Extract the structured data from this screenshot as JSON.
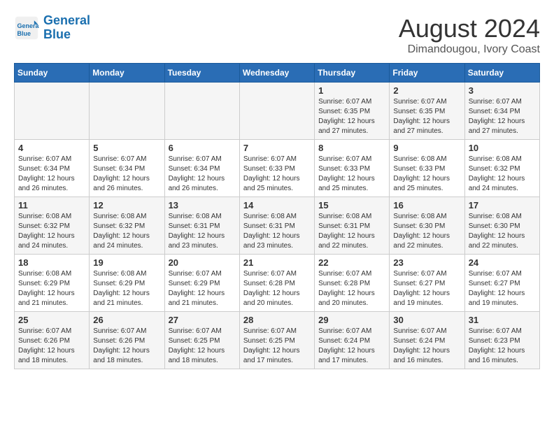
{
  "header": {
    "logo_line1": "General",
    "logo_line2": "Blue",
    "month_year": "August 2024",
    "location": "Dimandougou, Ivory Coast"
  },
  "days_of_week": [
    "Sunday",
    "Monday",
    "Tuesday",
    "Wednesday",
    "Thursday",
    "Friday",
    "Saturday"
  ],
  "weeks": [
    [
      {
        "day": "",
        "info": ""
      },
      {
        "day": "",
        "info": ""
      },
      {
        "day": "",
        "info": ""
      },
      {
        "day": "",
        "info": ""
      },
      {
        "day": "1",
        "info": "Sunrise: 6:07 AM\nSunset: 6:35 PM\nDaylight: 12 hours\nand 27 minutes."
      },
      {
        "day": "2",
        "info": "Sunrise: 6:07 AM\nSunset: 6:35 PM\nDaylight: 12 hours\nand 27 minutes."
      },
      {
        "day": "3",
        "info": "Sunrise: 6:07 AM\nSunset: 6:34 PM\nDaylight: 12 hours\nand 27 minutes."
      }
    ],
    [
      {
        "day": "4",
        "info": "Sunrise: 6:07 AM\nSunset: 6:34 PM\nDaylight: 12 hours\nand 26 minutes."
      },
      {
        "day": "5",
        "info": "Sunrise: 6:07 AM\nSunset: 6:34 PM\nDaylight: 12 hours\nand 26 minutes."
      },
      {
        "day": "6",
        "info": "Sunrise: 6:07 AM\nSunset: 6:34 PM\nDaylight: 12 hours\nand 26 minutes."
      },
      {
        "day": "7",
        "info": "Sunrise: 6:07 AM\nSunset: 6:33 PM\nDaylight: 12 hours\nand 25 minutes."
      },
      {
        "day": "8",
        "info": "Sunrise: 6:07 AM\nSunset: 6:33 PM\nDaylight: 12 hours\nand 25 minutes."
      },
      {
        "day": "9",
        "info": "Sunrise: 6:08 AM\nSunset: 6:33 PM\nDaylight: 12 hours\nand 25 minutes."
      },
      {
        "day": "10",
        "info": "Sunrise: 6:08 AM\nSunset: 6:32 PM\nDaylight: 12 hours\nand 24 minutes."
      }
    ],
    [
      {
        "day": "11",
        "info": "Sunrise: 6:08 AM\nSunset: 6:32 PM\nDaylight: 12 hours\nand 24 minutes."
      },
      {
        "day": "12",
        "info": "Sunrise: 6:08 AM\nSunset: 6:32 PM\nDaylight: 12 hours\nand 24 minutes."
      },
      {
        "day": "13",
        "info": "Sunrise: 6:08 AM\nSunset: 6:31 PM\nDaylight: 12 hours\nand 23 minutes."
      },
      {
        "day": "14",
        "info": "Sunrise: 6:08 AM\nSunset: 6:31 PM\nDaylight: 12 hours\nand 23 minutes."
      },
      {
        "day": "15",
        "info": "Sunrise: 6:08 AM\nSunset: 6:31 PM\nDaylight: 12 hours\nand 22 minutes."
      },
      {
        "day": "16",
        "info": "Sunrise: 6:08 AM\nSunset: 6:30 PM\nDaylight: 12 hours\nand 22 minutes."
      },
      {
        "day": "17",
        "info": "Sunrise: 6:08 AM\nSunset: 6:30 PM\nDaylight: 12 hours\nand 22 minutes."
      }
    ],
    [
      {
        "day": "18",
        "info": "Sunrise: 6:08 AM\nSunset: 6:29 PM\nDaylight: 12 hours\nand 21 minutes."
      },
      {
        "day": "19",
        "info": "Sunrise: 6:08 AM\nSunset: 6:29 PM\nDaylight: 12 hours\nand 21 minutes."
      },
      {
        "day": "20",
        "info": "Sunrise: 6:07 AM\nSunset: 6:29 PM\nDaylight: 12 hours\nand 21 minutes."
      },
      {
        "day": "21",
        "info": "Sunrise: 6:07 AM\nSunset: 6:28 PM\nDaylight: 12 hours\nand 20 minutes."
      },
      {
        "day": "22",
        "info": "Sunrise: 6:07 AM\nSunset: 6:28 PM\nDaylight: 12 hours\nand 20 minutes."
      },
      {
        "day": "23",
        "info": "Sunrise: 6:07 AM\nSunset: 6:27 PM\nDaylight: 12 hours\nand 19 minutes."
      },
      {
        "day": "24",
        "info": "Sunrise: 6:07 AM\nSunset: 6:27 PM\nDaylight: 12 hours\nand 19 minutes."
      }
    ],
    [
      {
        "day": "25",
        "info": "Sunrise: 6:07 AM\nSunset: 6:26 PM\nDaylight: 12 hours\nand 18 minutes."
      },
      {
        "day": "26",
        "info": "Sunrise: 6:07 AM\nSunset: 6:26 PM\nDaylight: 12 hours\nand 18 minutes."
      },
      {
        "day": "27",
        "info": "Sunrise: 6:07 AM\nSunset: 6:25 PM\nDaylight: 12 hours\nand 18 minutes."
      },
      {
        "day": "28",
        "info": "Sunrise: 6:07 AM\nSunset: 6:25 PM\nDaylight: 12 hours\nand 17 minutes."
      },
      {
        "day": "29",
        "info": "Sunrise: 6:07 AM\nSunset: 6:24 PM\nDaylight: 12 hours\nand 17 minutes."
      },
      {
        "day": "30",
        "info": "Sunrise: 6:07 AM\nSunset: 6:24 PM\nDaylight: 12 hours\nand 16 minutes."
      },
      {
        "day": "31",
        "info": "Sunrise: 6:07 AM\nSunset: 6:23 PM\nDaylight: 12 hours\nand 16 minutes."
      }
    ]
  ]
}
